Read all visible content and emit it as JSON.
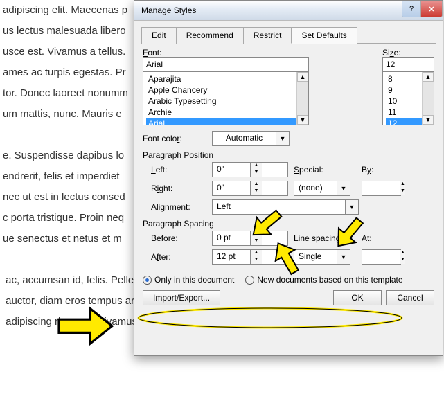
{
  "bg_text": "adipiscing elit. Maecenas p\nus lectus malesuada libero\nusce est. Vivamus a tellus.\names ac turpis egestas. Pr\ntor. Donec laoreet nonumm\num mattis, nunc. Mauris e\n\ne. Suspendisse dapibus lo\nendrerit, felis et imperdiet\nnec ut est in lectus consed\nc porta tristique. Proin neq\nue senectus et netus et m\n\n ac, accumsan id, felis. Pellentesque cursus sagittis felis.                Maecenas port\n auctor, diam eros tempus arcu, nec vulputate augue                             malesuada\n adipiscing rhoncus. Vivamus a mi. Morbi neque. Aliquam                    Nunc viverra im",
  "dialog": {
    "title": "Manage Styles",
    "tabs": {
      "edit": "Edit",
      "recommend": "Recommend",
      "restrict": "Restrict",
      "defaults": "Set Defaults"
    },
    "font": {
      "label": "Font:",
      "value": "Arial",
      "items": [
        "Aparajita",
        "Apple Chancery",
        "Arabic Typesetting",
        "Archie",
        "Arial"
      ]
    },
    "size": {
      "label": "Size:",
      "value": "12",
      "items": [
        "8",
        "9",
        "10",
        "11",
        "12"
      ]
    },
    "font_color": {
      "label": "Font color:",
      "value": "Automatic"
    },
    "para_position": {
      "label": "Paragraph Position",
      "left_lbl": "Left:",
      "left_val": "0\"",
      "right_lbl": "Right:",
      "right_val": "0\"",
      "special_lbl": "Special:",
      "special_val": "(none)",
      "by_lbl": "By:",
      "align_lbl": "Alignment:",
      "align_val": "Left"
    },
    "para_spacing": {
      "label": "Paragraph Spacing",
      "before_lbl": "Before:",
      "before_val": "0 pt",
      "after_lbl": "After:",
      "after_val": "12 pt",
      "line_lbl": "Line spacing:",
      "line_val": "Single",
      "at_lbl": "At:"
    },
    "radios": {
      "only": "Only in this document",
      "new": "New documents based on this template"
    },
    "footer": {
      "import": "Import/Export...",
      "ok": "OK",
      "cancel": "Cancel"
    }
  }
}
